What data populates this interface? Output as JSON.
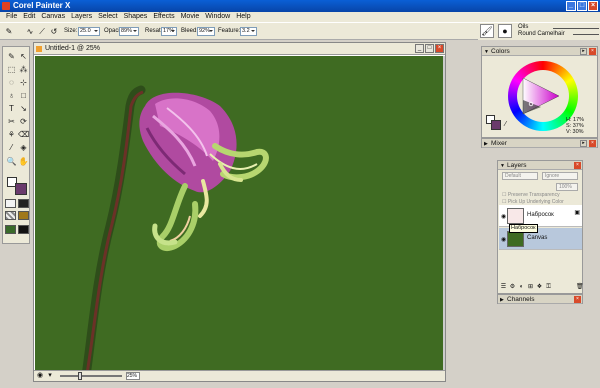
{
  "app": {
    "title": "Corel Painter X",
    "window_buttons": [
      "_",
      "□",
      "×"
    ]
  },
  "menu": [
    "File",
    "Edit",
    "Canvas",
    "Layers",
    "Select",
    "Shapes",
    "Effects",
    "Movie",
    "Window",
    "Help"
  ],
  "property_bar": {
    "size_label": "Size:",
    "size_value": "25.0",
    "opacity_label": "Opacity:",
    "opacity_value": "89%",
    "resat_label": "Resat:",
    "resat_value": "17%",
    "bleed_label": "Bleed:",
    "bleed_value": "92%",
    "feature_label": "Feature:",
    "feature_value": "3.2"
  },
  "brush_selector": {
    "category": "Oils",
    "variant": "Round Camelhair"
  },
  "document": {
    "title": "Untitled-1 @ 25%",
    "zoom": "25%",
    "doc_buttons": [
      "_",
      "□",
      "×"
    ]
  },
  "colors_panel": {
    "title": "Colors",
    "hsv": [
      "H: 17%",
      "S: 37%",
      "V: 30%"
    ],
    "mixer_title": "Mixer",
    "main_color": "#ffffff",
    "additional_color": "#6a3a6c"
  },
  "layers_panel": {
    "title": "Layers",
    "composite_method": "Default",
    "composite_depth": "Ignore",
    "opacity": "100%",
    "preserve_transparency": "Preserve Transparency",
    "pick_up_underlying": "Pick Up Underlying Color",
    "layers": [
      {
        "name": "Набросок"
      },
      {
        "name": "Canvas"
      }
    ],
    "tooltip": "Набросок"
  },
  "channels_panel": {
    "title": "Channels"
  }
}
